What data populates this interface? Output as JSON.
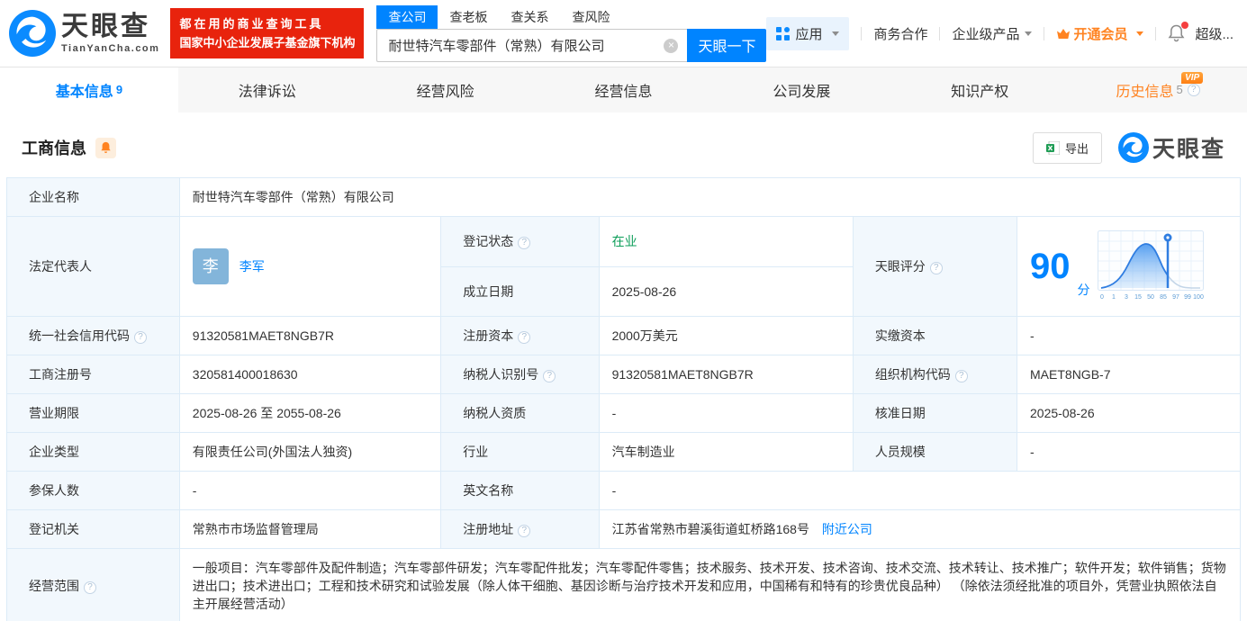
{
  "header": {
    "logo_title": "天眼查",
    "logo_domain": "TianYanCha.com",
    "slogan_line1": "都在用的商业查询工具",
    "slogan_line2": "国家中小企业发展子基金旗下机构",
    "search_tabs": [
      {
        "label": "查公司"
      },
      {
        "label": "查老板"
      },
      {
        "label": "查关系"
      },
      {
        "label": "查风险"
      }
    ],
    "search_value": "耐世特汽车零部件（常熟）有限公司",
    "search_button": "天眼一下",
    "nav_apps": "应用",
    "nav_cooperation": "商务合作",
    "nav_enterprise": "企业级产品",
    "nav_vip": "开通会员",
    "nav_user": "超级..."
  },
  "page_tabs": {
    "basic": {
      "label": "基本信息",
      "count": "9"
    },
    "legal": {
      "label": "法律诉讼"
    },
    "risk": {
      "label": "经营风险"
    },
    "operation": {
      "label": "经营信息"
    },
    "development": {
      "label": "公司发展"
    },
    "ip": {
      "label": "知识产权"
    },
    "history": {
      "label": "历史信息",
      "count": "5",
      "badge": "VIP"
    }
  },
  "section": {
    "title": "工商信息",
    "export_label": "导出",
    "watermark": "天眼查"
  },
  "fields": {
    "company_name": {
      "label": "企业名称",
      "value": "耐世特汽车零部件（常熟）有限公司"
    },
    "legal_rep": {
      "label": "法定代表人",
      "value": "李军",
      "avatar": "李"
    },
    "reg_status": {
      "label": "登记状态",
      "value": "在业"
    },
    "establish_date": {
      "label": "成立日期",
      "value": "2025-08-26"
    },
    "credit_code": {
      "label": "统一社会信用代码",
      "value": "91320581MAET8NGB7R"
    },
    "reg_capital": {
      "label": "注册资本",
      "value": "2000万美元"
    },
    "paid_capital": {
      "label": "实缴资本",
      "value": "-"
    },
    "reg_number": {
      "label": "工商注册号",
      "value": "320581400018630"
    },
    "taxpayer_id": {
      "label": "纳税人识别号",
      "value": "91320581MAET8NGB7R"
    },
    "org_code": {
      "label": "组织机构代码",
      "value": "MAET8NGB-7"
    },
    "business_term": {
      "label": "营业期限",
      "value": "2025-08-26 至 2055-08-26"
    },
    "taxpayer_quality": {
      "label": "纳税人资质",
      "value": "-"
    },
    "approval_date": {
      "label": "核准日期",
      "value": "2025-08-26"
    },
    "company_type": {
      "label": "企业类型",
      "value": "有限责任公司(外国法人独资)"
    },
    "industry": {
      "label": "行业",
      "value": "汽车制造业"
    },
    "staff_size": {
      "label": "人员规模",
      "value": "-"
    },
    "insured_count": {
      "label": "参保人数",
      "value": "-"
    },
    "english_name": {
      "label": "英文名称",
      "value": "-"
    },
    "reg_authority": {
      "label": "登记机关",
      "value": "常熟市市场监督管理局"
    },
    "reg_address": {
      "label": "注册地址",
      "value": "江苏省常熟市碧溪街道虹桥路168号",
      "link": "附近公司"
    },
    "business_scope": {
      "label": "经营范围",
      "value": "一般项目：汽车零部件及配件制造；汽车零部件研发；汽车零配件批发；汽车零配件零售；技术服务、技术开发、技术咨询、技术交流、技术转让、技术推广；软件开发；软件销售；货物进出口；技术进出口；工程和技术研究和试验发展（除人体干细胞、基因诊断与治疗技术开发和应用，中国稀有和特有的珍贵优良品种） （除依法须经批准的项目外，凭营业执照依法自主开展经营活动）"
    }
  },
  "score": {
    "label": "天眼评分",
    "value": "90",
    "unit": "分",
    "axis": [
      "0",
      "1",
      "3",
      "15",
      "50",
      "85",
      "97",
      "99",
      "100"
    ]
  },
  "colors": {
    "accent_blue": "#0084ff",
    "status_green": "#0b9d58",
    "vip_orange": "#ff8321",
    "banner_red": "#e8230d"
  }
}
